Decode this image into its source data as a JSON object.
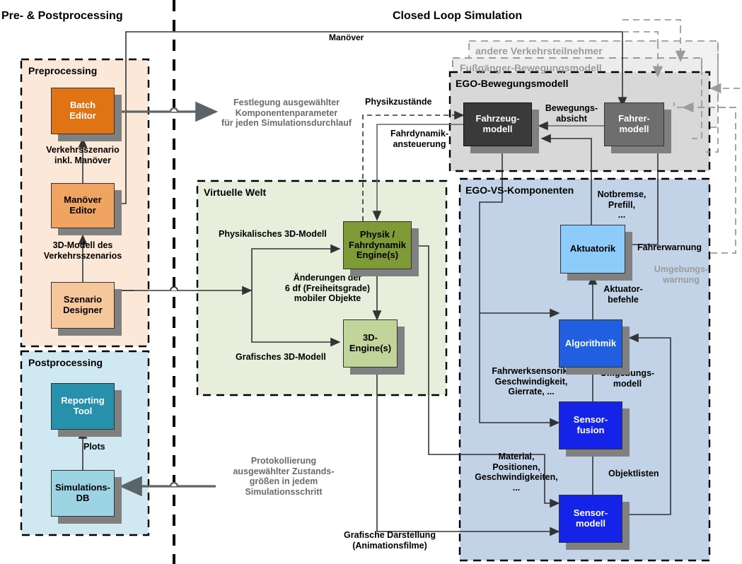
{
  "headers": {
    "left": "Pre- & Postprocessing",
    "right": "Closed Loop Simulation"
  },
  "groups": {
    "preprocessing": {
      "title": "Preprocessing",
      "fill": "#fce8d8",
      "border": "#000000"
    },
    "postprocessing": {
      "title": "Postprocessing",
      "fill": "#cfe8f2",
      "border": "#000000"
    },
    "virtuelle_welt": {
      "title": "Virtuelle Welt",
      "fill": "#e8eedc",
      "border": "#000000"
    },
    "ego_bewegungsmodell": {
      "title": "EGO-Bewegungsmodell",
      "fill": "#d8d8d8",
      "border": "#000000"
    },
    "ego_vs_komponenten": {
      "title": "EGO-VS-Komponenten",
      "fill": "#c2d3e8",
      "border": "#000000"
    },
    "fussgaenger": {
      "title": "Fußgänger-Bewegungsmodell",
      "fill": "#ececec",
      "border": "#9b9b9b"
    },
    "andere_verkehrsteilnehmer": {
      "title": "andere Verkehrsteilnehmer",
      "fill": "#f0f0f0",
      "border": "#a8a8a8"
    }
  },
  "nodes": {
    "batch_editor": {
      "label": "Batch\nEditor",
      "fill": "#e07414",
      "text": "#ffffff"
    },
    "manoever_editor": {
      "label": "Manöver\nEditor",
      "fill": "#f0a461",
      "text": "#000000"
    },
    "szenario_designer": {
      "label": "Szenario\nDesigner",
      "fill": "#f6c79a",
      "text": "#000000"
    },
    "reporting_tool": {
      "label": "Reporting\nTool",
      "fill": "#2790ad",
      "text": "#ffffff"
    },
    "simulations_db": {
      "label": "Simulations-\nDB",
      "fill": "#9dd4e3",
      "text": "#000000"
    },
    "physik_engine": {
      "label": "Physik /\nFahrdynamik\nEngine(s)",
      "fill": "#7f9b37",
      "text": "#000000"
    },
    "dreid_engine": {
      "label": "3D-\nEngine(s)",
      "fill": "#c1d49a",
      "text": "#000000"
    },
    "fahrzeugmodell": {
      "label": "Fahrzeug-\nmodell",
      "fill": "#3a3a3a",
      "text": "#ffffff"
    },
    "fahrermodell": {
      "label": "Fahrer-\nmodell",
      "fill": "#6e6e6e",
      "text": "#ffffff"
    },
    "aktuatorik": {
      "label": "Aktuatorik",
      "fill": "#8ccbfa",
      "text": "#000000"
    },
    "algorithmik": {
      "label": "Algorithmik",
      "fill": "#1f5fe0",
      "text": "#ffffff"
    },
    "sensorfusion": {
      "label": "Sensor-\nfusion",
      "fill": "#1522e8",
      "text": "#ffffff"
    },
    "sensormodell": {
      "label": "Sensor-\nmodell",
      "fill": "#1522e8",
      "text": "#ffffff"
    }
  },
  "edge_labels": {
    "manoever": "Manöver",
    "festlegung": "Festlegung ausgewählter\nKomponentenparameter\nfür jeden Simulationsdurchlauf",
    "verkehrsszenario": "Verkehrsszenario\ninkl. Manöver",
    "modell3d_verkehr": "3D-Modell des\nVerkehrsszenarios",
    "plots": "Plots",
    "protokollierung": "Protokollierung\nausgewählter Zustands-\ngrößen in jedem\nSimulationsschritt",
    "physikzustaende": "Physikzustände",
    "fahrdynamikansteuerung": "Fahrdynamik-\nansteuerung",
    "physikalisches_3d": "Physikalisches 3D-Modell",
    "grafisches_3d": "Grafisches 3D-Modell",
    "aenderungen": "Änderungen der\n6 df (Freiheitsgrade)\nmobiler Objekte",
    "bewegungsabsicht": "Bewegungs-\nabsicht",
    "notbremse": "Notbremse,\nPrefill,\n...",
    "fahrerwarnung": "Fahrerwarnung",
    "umgebungswarnung": "Umgebungs-\nwarnung",
    "aktuatorbefehle": "Aktuator-\nbefehle",
    "umgebungsmodell": "Umgebungs-\nmodell",
    "fahrwerksensorik": "Fahrwerksensorik:\nGeschwindigkeit,\nGierrate, ...",
    "objektlisten": "Objektlisten",
    "material": "Material,\nPositionen,\nGeschwindigkeiten,\n...",
    "grafische_darstellung": "Grafische Darstellung\n(Animationsfilme)"
  },
  "colors": {
    "line_dark": "#333333",
    "line_grey": "#5a6568",
    "line_light_grey": "#9b9b9b",
    "shadow": "#808080",
    "divider": "#000000"
  }
}
